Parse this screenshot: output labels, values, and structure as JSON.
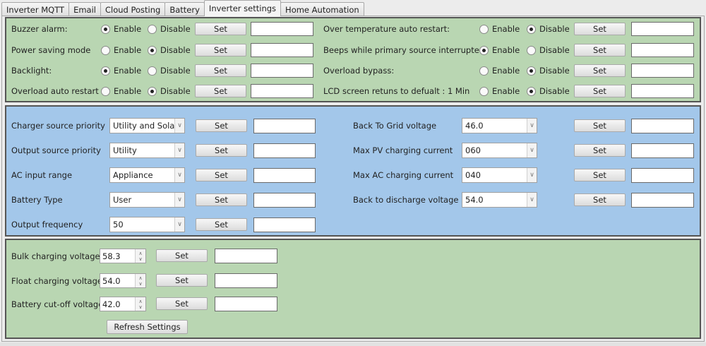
{
  "tabs": [
    "Inverter  MQTT",
    "Email",
    "Cloud Posting",
    "Battery",
    "Inverter settings",
    "Home Automation"
  ],
  "active_tab": "Inverter settings",
  "radio_options": {
    "enable": "Enable",
    "disable": "Disable"
  },
  "set_label": "Set",
  "toggles": [
    {
      "label": "Buzzer alarm:",
      "selected": "enable",
      "feedback": ""
    },
    {
      "label": "Power saving mode",
      "selected": "disable",
      "feedback": ""
    },
    {
      "label": "Backlight:",
      "selected": "enable",
      "feedback": ""
    },
    {
      "label": "Overload auto restart",
      "selected": "disable",
      "feedback": ""
    },
    {
      "label": "Over temperature auto restart:",
      "selected": "disable",
      "feedback": ""
    },
    {
      "label": "Beeps while primary source interrupted:",
      "selected": "enable",
      "feedback": ""
    },
    {
      "label": "Overload bypass:",
      "selected": "disable",
      "feedback": ""
    },
    {
      "label": "LCD screen retuns to defualt : 1 Min",
      "selected": "disable",
      "feedback": ""
    }
  ],
  "selects": [
    {
      "label": "Charger source priority",
      "value": "Utility and Solar",
      "feedback": ""
    },
    {
      "label": "Output source priority",
      "value": "Utility",
      "feedback": ""
    },
    {
      "label": "AC input range",
      "value": "Appliance",
      "feedback": ""
    },
    {
      "label": "Battery Type",
      "value": "User",
      "feedback": ""
    },
    {
      "label": "Output frequency",
      "value": "50",
      "feedback": ""
    },
    {
      "label": "Back To Grid voltage",
      "value": "46.0",
      "feedback": ""
    },
    {
      "label": "Max PV charging current",
      "value": "060",
      "feedback": ""
    },
    {
      "label": "Max AC charging current",
      "value": "040",
      "feedback": ""
    },
    {
      "label": "Back to discharge voltage",
      "value": "54.0",
      "feedback": ""
    }
  ],
  "voltages": [
    {
      "label": "Bulk charging voltage",
      "value": "58.3",
      "feedback": ""
    },
    {
      "label": "Float charging voltage",
      "value": "54.0",
      "feedback": ""
    },
    {
      "label": "Battery cut-off voltage",
      "value": "42.0",
      "feedback": ""
    }
  ],
  "refresh_label": "Refresh Settings",
  "colors": {
    "green_panel": "#b9d6b2",
    "blue_panel": "#a3c7ea"
  }
}
